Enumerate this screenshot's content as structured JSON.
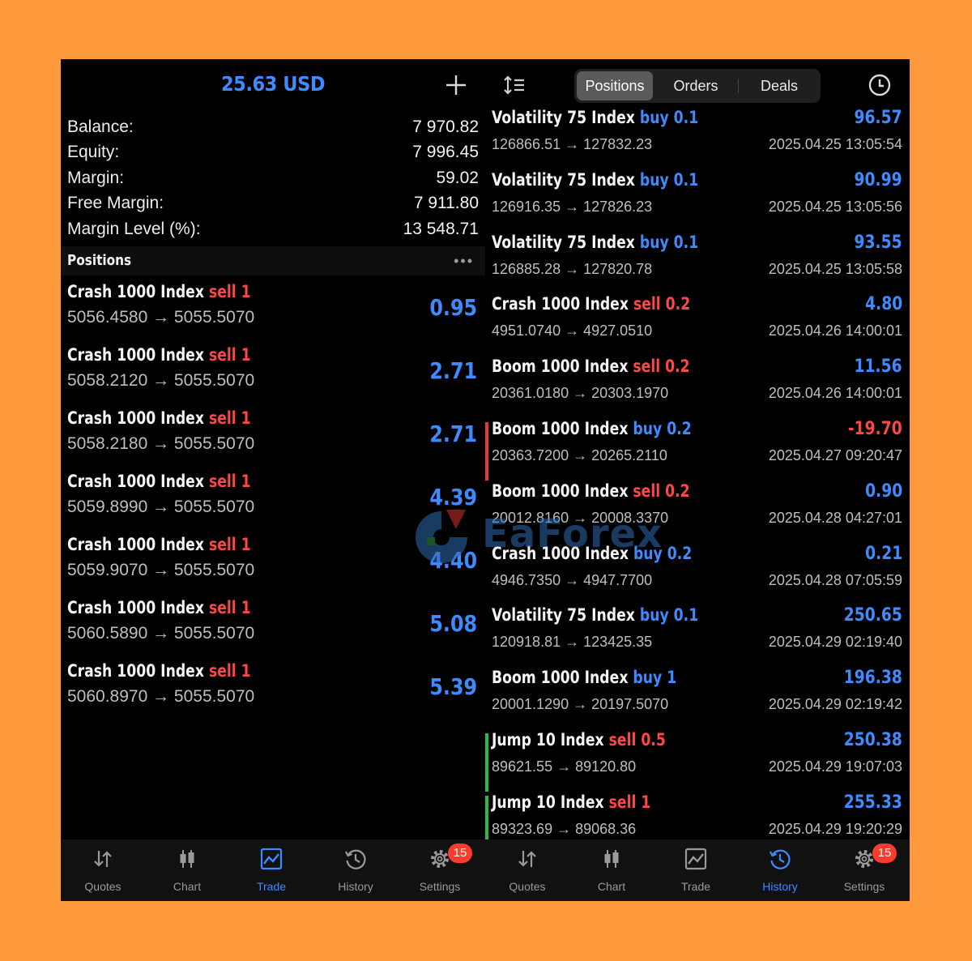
{
  "left": {
    "balance_title": "25.63 USD",
    "summary": [
      {
        "label": "Balance:",
        "value": "7 970.82"
      },
      {
        "label": "Equity:",
        "value": "7 996.45"
      },
      {
        "label": "Margin:",
        "value": "59.02"
      },
      {
        "label": "Free Margin:",
        "value": "7 911.80"
      },
      {
        "label": "Margin Level (%):",
        "value": "13 548.71"
      }
    ],
    "positions_title": "Positions",
    "positions_more": "•••",
    "positions": [
      {
        "symbol": "Crash 1000 Index",
        "side": "sell",
        "volume": "1",
        "prices": "5056.4580 → 5055.5070",
        "profit": "0.95"
      },
      {
        "symbol": "Crash 1000 Index",
        "side": "sell",
        "volume": "1",
        "prices": "5058.2120 → 5055.5070",
        "profit": "2.71"
      },
      {
        "symbol": "Crash 1000 Index",
        "side": "sell",
        "volume": "1",
        "prices": "5058.2180 → 5055.5070",
        "profit": "2.71"
      },
      {
        "symbol": "Crash 1000 Index",
        "side": "sell",
        "volume": "1",
        "prices": "5059.8990 → 5055.5070",
        "profit": "4.39"
      },
      {
        "symbol": "Crash 1000 Index",
        "side": "sell",
        "volume": "1",
        "prices": "5059.9070 → 5055.5070",
        "profit": "4.40"
      },
      {
        "symbol": "Crash 1000 Index",
        "side": "sell",
        "volume": "1",
        "prices": "5060.5890 → 5055.5070",
        "profit": "5.08"
      },
      {
        "symbol": "Crash 1000 Index",
        "side": "sell",
        "volume": "1",
        "prices": "5060.8970 → 5055.5070",
        "profit": "5.39"
      }
    ],
    "nav": [
      {
        "label": "Quotes",
        "icon": "quotes-icon",
        "active": false
      },
      {
        "label": "Chart",
        "icon": "chart-icon",
        "active": false
      },
      {
        "label": "Trade",
        "icon": "trade-icon",
        "active": true
      },
      {
        "label": "History",
        "icon": "history-icon",
        "active": false
      },
      {
        "label": "Settings",
        "icon": "settings-icon",
        "active": false,
        "badge": "15"
      }
    ]
  },
  "right": {
    "tabs": [
      {
        "label": "Positions",
        "active": true
      },
      {
        "label": "Orders",
        "active": false
      },
      {
        "label": "Deals",
        "active": false
      }
    ],
    "deals": [
      {
        "symbol": "Volatility 75 Index",
        "side": "buy",
        "volume": "0.1",
        "prices": "126866.51 → 127832.23",
        "profit": "96.57",
        "time": "2025.04.25 13:05:54",
        "bar": ""
      },
      {
        "symbol": "Volatility 75 Index",
        "side": "buy",
        "volume": "0.1",
        "prices": "126916.35 → 127826.23",
        "profit": "90.99",
        "time": "2025.04.25 13:05:56",
        "bar": ""
      },
      {
        "symbol": "Volatility 75 Index",
        "side": "buy",
        "volume": "0.1",
        "prices": "126885.28 → 127820.78",
        "profit": "93.55",
        "time": "2025.04.25 13:05:58",
        "bar": ""
      },
      {
        "symbol": "Crash 1000 Index",
        "side": "sell",
        "volume": "0.2",
        "prices": "4951.0740 → 4927.0510",
        "profit": "4.80",
        "time": "2025.04.26 14:00:01",
        "bar": ""
      },
      {
        "symbol": "Boom 1000 Index",
        "side": "sell",
        "volume": "0.2",
        "prices": "20361.0180 → 20303.1970",
        "profit": "11.56",
        "time": "2025.04.26 14:00:01",
        "bar": ""
      },
      {
        "symbol": "Boom 1000 Index",
        "side": "buy",
        "volume": "0.2",
        "prices": "20363.7200 → 20265.2110",
        "profit": "-19.70",
        "time": "2025.04.27 09:20:47",
        "bar": "#E23B36"
      },
      {
        "symbol": "Boom 1000 Index",
        "side": "sell",
        "volume": "0.2",
        "prices": "20012.8160 → 20008.3370",
        "profit": "0.90",
        "time": "2025.04.28 04:27:01",
        "bar": ""
      },
      {
        "symbol": "Crash 1000 Index",
        "side": "buy",
        "volume": "0.2",
        "prices": "4946.7350 → 4947.7700",
        "profit": "0.21",
        "time": "2025.04.28 07:05:59",
        "bar": ""
      },
      {
        "symbol": "Volatility 75 Index",
        "side": "buy",
        "volume": "0.1",
        "prices": "120918.81 → 123425.35",
        "profit": "250.65",
        "time": "2025.04.29 02:19:40",
        "bar": ""
      },
      {
        "symbol": "Boom 1000 Index",
        "side": "buy",
        "volume": "1",
        "prices": "20001.1290 → 20197.5070",
        "profit": "196.38",
        "time": "2025.04.29 02:19:42",
        "bar": ""
      },
      {
        "symbol": "Jump 10 Index",
        "side": "sell",
        "volume": "0.5",
        "prices": "89621.55 → 89120.80",
        "profit": "250.38",
        "time": "2025.04.29 19:07:03",
        "bar": "#2EB84B"
      },
      {
        "symbol": "Jump 10 Index",
        "side": "sell",
        "volume": "1",
        "prices": "89323.69 → 89068.36",
        "profit": "255.33",
        "time": "2025.04.29 19:20:29",
        "bar": "#2EB84B"
      }
    ],
    "nav": [
      {
        "label": "Quotes",
        "icon": "quotes-icon",
        "active": false
      },
      {
        "label": "Chart",
        "icon": "chart-icon",
        "active": false
      },
      {
        "label": "Trade",
        "icon": "trade-icon",
        "active": false
      },
      {
        "label": "History",
        "icon": "history-icon",
        "active": true
      },
      {
        "label": "Settings",
        "icon": "settings-icon",
        "active": false,
        "badge": "15"
      }
    ]
  },
  "watermark": {
    "text": "EaForex",
    "icon": "watermark-logo-icon"
  },
  "colors": {
    "background": "#FF9A3C",
    "accent": "#3E8BFF",
    "sell": "#FF4747",
    "profit": "#3E8BFF",
    "loss": "#FF4747"
  }
}
